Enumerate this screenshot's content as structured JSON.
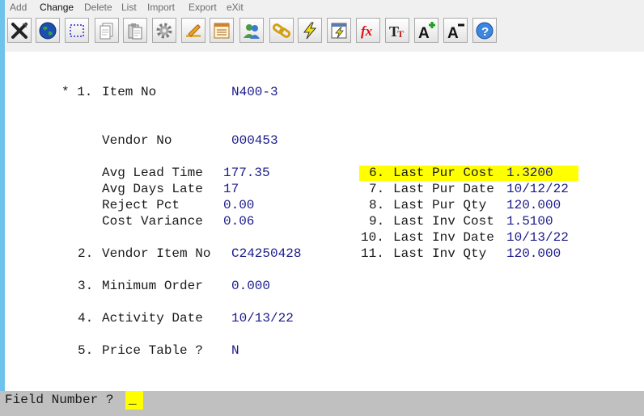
{
  "menu": [
    "Add",
    "Change",
    "Delete",
    "List",
    "Import",
    "Export",
    "eXit"
  ],
  "toolbar": [
    "close-x-icon",
    "globe-icon",
    "select-box-icon",
    "copy-page-icon",
    "paste-icon",
    "gear-icon",
    "pencil-icon",
    "form-icon",
    "users-icon",
    "chain-link-icon",
    "lightning-icon",
    "window-lightning-icon",
    "function-fx-icon",
    "font-size-icon",
    "font-increase-icon",
    "font-decrease-icon",
    "help-icon"
  ],
  "form": {
    "item_no_marker": "* 1.",
    "item_no_label": "Item No",
    "item_no_value": "N400-3",
    "vendor_no_label": "Vendor No",
    "vendor_no_value": "000453",
    "avg_lead_time_label": "Avg Lead Time",
    "avg_lead_time_value": "177.35",
    "avg_days_late_label": "Avg Days Late",
    "avg_days_late_value": "17",
    "reject_pct_label": "Reject Pct",
    "reject_pct_value": "0.00",
    "cost_variance_label": "Cost Variance",
    "cost_variance_value": "0.06",
    "vendor_item_no_num": "2.",
    "vendor_item_no_label": "Vendor Item No",
    "vendor_item_no_value": "C24250428",
    "minimum_order_num": "3.",
    "minimum_order_label": "Minimum Order",
    "minimum_order_value": "0.000",
    "activity_date_num": "4.",
    "activity_date_label": "Activity Date",
    "activity_date_value": "10/13/22",
    "price_table_num": "5.",
    "price_table_label": "Price Table ?",
    "price_table_value": "N",
    "last_pur_cost_num": "6.",
    "last_pur_cost_label": "Last Pur Cost",
    "last_pur_cost_value": "1.3200",
    "last_pur_date_num": "7.",
    "last_pur_date_label": "Last Pur Date",
    "last_pur_date_value": "10/12/22",
    "last_pur_qty_num": "8.",
    "last_pur_qty_label": "Last Pur Qty",
    "last_pur_qty_value": "120.000",
    "last_inv_cost_num": "9.",
    "last_inv_cost_label": "Last Inv Cost",
    "last_inv_cost_value": "1.5100",
    "last_inv_date_num": "10.",
    "last_inv_date_label": "Last Inv Date",
    "last_inv_date_value": "10/13/22",
    "last_inv_qty_num": "11.",
    "last_inv_qty_label": "Last Inv Qty",
    "last_inv_qty_value": "120.000"
  },
  "status": {
    "prompt": "Field Number ?",
    "cursor": "_"
  },
  "colors": {
    "highlight": "#ffff00",
    "value_text": "#1a1a8c",
    "status_bar": "#c0c0c0",
    "left_stripe": "#6ec2ec"
  }
}
